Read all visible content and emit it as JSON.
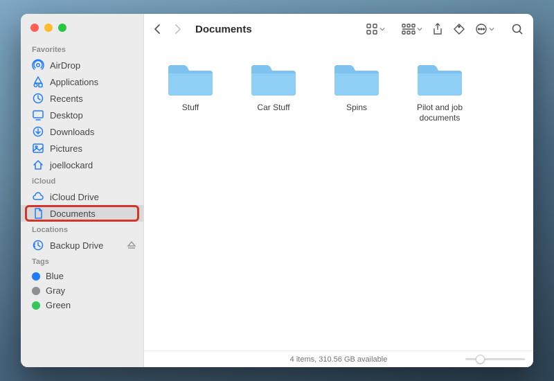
{
  "window": {
    "title": "Documents"
  },
  "sidebar": {
    "sections": [
      {
        "header": "Favorites",
        "items": [
          {
            "icon": "airdrop",
            "label": "AirDrop"
          },
          {
            "icon": "applications",
            "label": "Applications"
          },
          {
            "icon": "recents",
            "label": "Recents"
          },
          {
            "icon": "desktop",
            "label": "Desktop"
          },
          {
            "icon": "downloads",
            "label": "Downloads"
          },
          {
            "icon": "pictures",
            "label": "Pictures"
          },
          {
            "icon": "home",
            "label": "joellockard"
          }
        ]
      },
      {
        "header": "iCloud",
        "items": [
          {
            "icon": "cloud",
            "label": "iCloud Drive"
          },
          {
            "icon": "document",
            "label": "Documents",
            "selected": true,
            "annotated": true
          }
        ]
      },
      {
        "header": "Locations",
        "items": [
          {
            "icon": "timemachine",
            "label": "Backup Drive",
            "eject": true
          }
        ]
      },
      {
        "header": "Tags",
        "items": [
          {
            "icon": "tag",
            "label": "Blue",
            "color": "#1f7cff"
          },
          {
            "icon": "tag",
            "label": "Gray",
            "color": "#8e8e93"
          },
          {
            "icon": "tag",
            "label": "Green",
            "color": "#34c759"
          }
        ]
      }
    ]
  },
  "folders": [
    {
      "name": "Stuff"
    },
    {
      "name": "Car Stuff"
    },
    {
      "name": "Spins"
    },
    {
      "name": "Pilot and job documents"
    }
  ],
  "status": {
    "count_text": "4 items",
    "available_text": "310.56 GB available"
  }
}
